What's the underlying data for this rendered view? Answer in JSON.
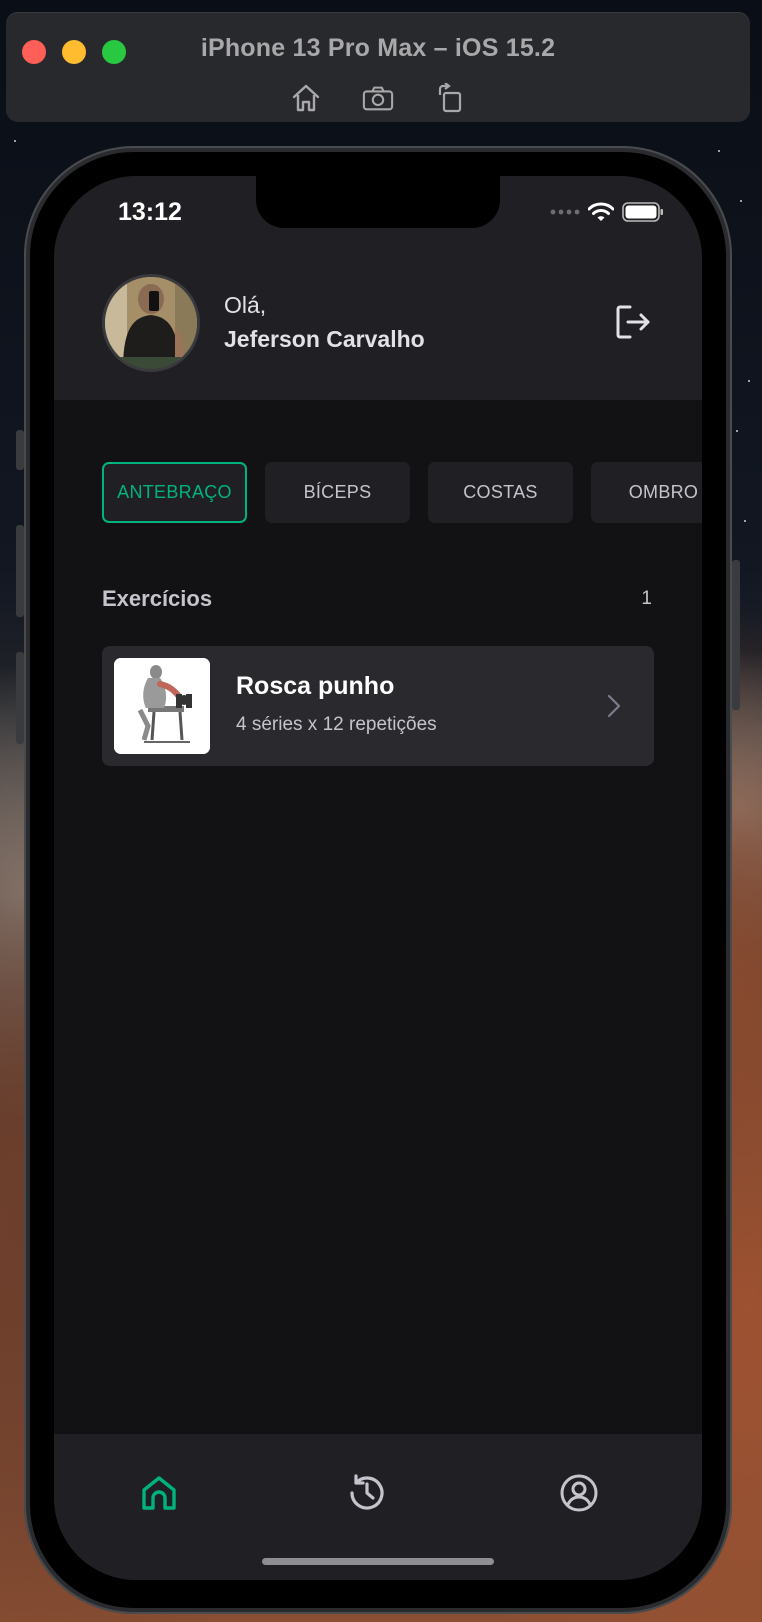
{
  "simulator": {
    "title": "iPhone 13 Pro Max – iOS 15.2",
    "tools": [
      "home-icon",
      "screenshot-icon",
      "rotate-icon"
    ]
  },
  "status_bar": {
    "time": "13:12"
  },
  "header": {
    "greeting": "Olá,",
    "user_name": "Jeferson Carvalho",
    "logout_icon": "sign-out-icon"
  },
  "groups": [
    {
      "label": "ANTEBRAÇO",
      "active": true
    },
    {
      "label": "BÍCEPS",
      "active": false
    },
    {
      "label": "COSTAS",
      "active": false
    },
    {
      "label": "OMBRO",
      "active": false
    }
  ],
  "exercises": {
    "heading": "Exercícios",
    "count": "1",
    "items": [
      {
        "title": "Rosca punho",
        "subtitle": "4 séries x 12 repetições",
        "icon": "chevron-right-icon"
      }
    ]
  },
  "tab_bar": {
    "tabs": [
      {
        "name": "home",
        "icon": "home-icon",
        "active": true
      },
      {
        "name": "history",
        "icon": "history-icon",
        "active": false
      },
      {
        "name": "profile",
        "icon": "user-circle-icon",
        "active": false
      }
    ]
  },
  "colors": {
    "accent": "#00b37e",
    "background": "#121214",
    "surface": "#202024",
    "card": "#29292e"
  }
}
